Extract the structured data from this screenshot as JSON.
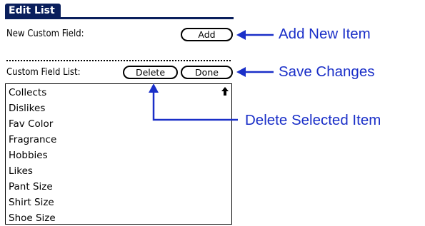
{
  "title": "Edit List",
  "new_field": {
    "label": "New Custom Field:",
    "add_label": "Add"
  },
  "list_section": {
    "label": "Custom Field List:",
    "delete_label": "Delete",
    "done_label": "Done"
  },
  "list": {
    "items": [
      "Collects",
      "Dislikes",
      "Fav Color",
      "Fragrance",
      "Hobbies",
      "Likes",
      "Pant Size",
      "Shirt Size",
      "Shoe Size"
    ]
  },
  "annotations": {
    "add": "Add New Item",
    "save": "Save Changes",
    "delete": "Delete Selected Item"
  },
  "colors": {
    "title_bar": "#0a1f5c",
    "annotation": "#1a2fc8"
  },
  "icons": {
    "scroll": "scroll-up-arrow-icon"
  }
}
